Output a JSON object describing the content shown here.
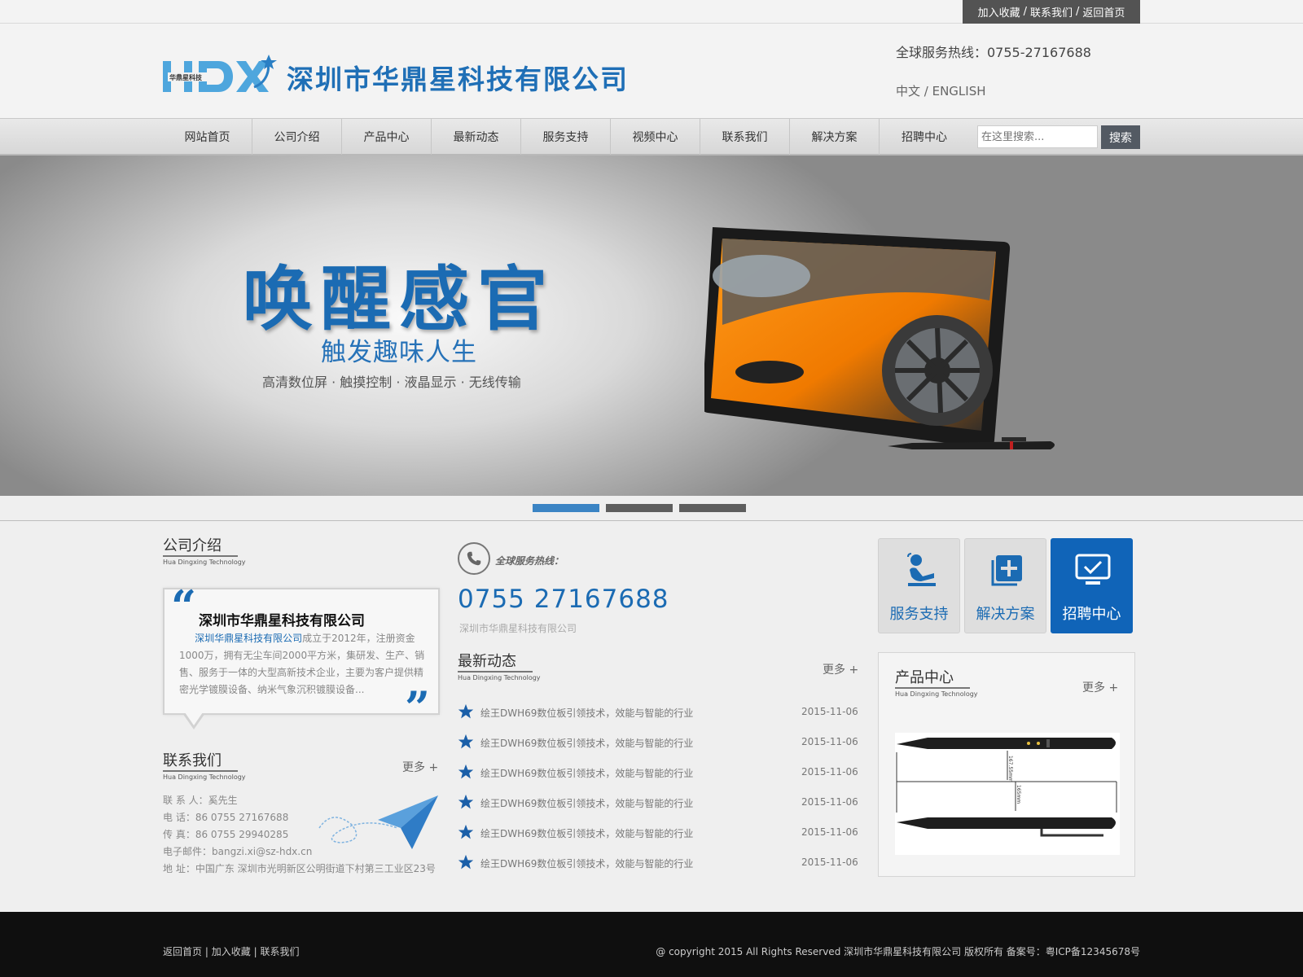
{
  "top_links": [
    "加入收藏",
    "联系我们",
    "返回首页"
  ],
  "top_separator": "/",
  "logo": {
    "badge": "华鼎星科技",
    "name": "深圳市华鼎星科技有限公司"
  },
  "header": {
    "hotline": "全球服务热线：0755-27167688",
    "language": "中文 / ENGLISH"
  },
  "nav": {
    "items": [
      "网站首页",
      "公司介绍",
      "产品中心",
      "最新动态",
      "服务支持",
      "视频中心",
      "联系我们",
      "解决方案",
      "招聘中心"
    ],
    "search_placeholder": "在这里搜索...",
    "search_button": "搜索"
  },
  "banner": {
    "title": "唤醒感官",
    "subtitle": "触发趣味人生",
    "tags": "高清数位屏 · 触摸控制 · 液晶显示 · 无线传输",
    "active_slide": 1,
    "slide_count": 3
  },
  "about": {
    "title": "公司介绍",
    "subtitle_en": "Hua Dingxing Technology",
    "company_name": "深圳市华鼎星科技有限公司",
    "highlight": "深圳华鼎星科技有限公司",
    "text": "成立于2012年，注册资金1000万，拥有无尘车间2000平方米，集研发、生产、销售、服务于一体的大型高新技术企业，主要为客户提供精密光学镀膜设备、纳米气象沉积镀膜设备..."
  },
  "contact": {
    "title": "联系我们",
    "subtitle_en": "Hua Dingxing Technology",
    "more": "更多 +",
    "lines": [
      "联 系 人：奚先生",
      "电 话：86 0755 27167688",
      "传 真：86 0755 29940285",
      "电子邮件：bangzi.xi@sz-hdx.cn",
      "地 址：中国广东 深圳市光明新区公明街道下村第三工业区23号"
    ]
  },
  "hotline": {
    "label": "全球服务热线：",
    "number": "0755 27167688",
    "company": "深圳市华鼎星科技有限公司"
  },
  "news": {
    "title": "最新动态",
    "subtitle_en": "Hua Dingxing Technology",
    "more": "更多 +",
    "items": [
      {
        "title": "绘王DWH69数位板引领技术，效能与智能的行业",
        "date": "2015-11-06"
      },
      {
        "title": "绘王DWH69数位板引领技术，效能与智能的行业",
        "date": "2015-11-06"
      },
      {
        "title": "绘王DWH69数位板引领技术，效能与智能的行业",
        "date": "2015-11-06"
      },
      {
        "title": "绘王DWH69数位板引领技术，效能与智能的行业",
        "date": "2015-11-06"
      },
      {
        "title": "绘王DWH69数位板引领技术，效能与智能的行业",
        "date": "2015-11-06"
      },
      {
        "title": "绘王DWH69数位板引领技术，效能与智能的行业",
        "date": "2015-11-06"
      }
    ]
  },
  "tiles": [
    {
      "label": "服务支持",
      "icon": "support-person-icon",
      "active": false
    },
    {
      "label": "解决方案",
      "icon": "add-square-icon",
      "active": false
    },
    {
      "label": "招聘中心",
      "icon": "monitor-check-icon",
      "active": true
    }
  ],
  "products": {
    "title": "产品中心",
    "subtitle_en": "Hua Dingxing Technology",
    "more": "更多 +",
    "dim_long": "167.55mm",
    "dim_short": "165mm"
  },
  "footer": {
    "links": [
      "返回首页",
      "加入收藏",
      "联系我们"
    ],
    "link_separator": "|",
    "copyright": "@ copyright 2015 All Rights Reserved 深圳市华鼎星科技有限公司 版权所有 备案号：粤ICP备12345678号"
  },
  "colors": {
    "brand_blue": "#1b6bb3",
    "dark_gray": "#535353",
    "footer_bg": "#0f0f0f"
  }
}
